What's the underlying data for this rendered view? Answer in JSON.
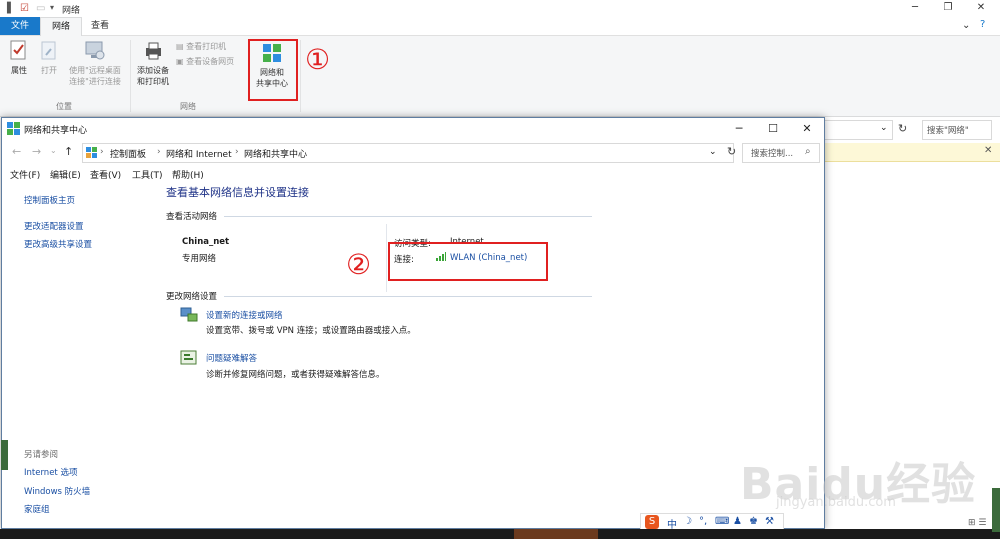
{
  "explorer": {
    "title": "网络",
    "tabs": [
      "文件",
      "网络",
      "查看"
    ],
    "ribbon": {
      "properties": "属性",
      "open": "打开",
      "remote_line1": "使用\"远程桌面",
      "remote_line2": "连接\"进行连接",
      "add_device_line1": "添加设备",
      "add_device_line2": "和打印机",
      "view_printers": "查看打印机",
      "view_device_page": "查看设备网页",
      "sharing_center_line1": "网络和",
      "sharing_center_line2": "共享中心",
      "group_location": "位置",
      "group_network": "网络"
    },
    "search_placeholder": "搜索\"网络\"",
    "annotation_1": "①"
  },
  "window": {
    "title": "网络和共享中心",
    "breadcrumb": [
      "控制面板",
      "网络和 Internet",
      "网络和共享中心"
    ],
    "search_placeholder": "搜索控制...",
    "menu": [
      "文件(F)",
      "编辑(E)",
      "查看(V)",
      "工具(T)",
      "帮助(H)"
    ],
    "sidebar": {
      "links": [
        "控制面板主页",
        "更改适配器设置",
        "更改高级共享设置"
      ],
      "see_also_title": "另请参阅",
      "see_also": [
        "Internet 选项",
        "Windows 防火墙",
        "家庭组"
      ]
    },
    "main": {
      "heading": "查看基本网络信息并设置连接",
      "active_networks": "查看活动网络",
      "network_name": "China_net",
      "network_type": "专用网络",
      "access_type_label": "访问类型:",
      "access_type_value": "Internet",
      "connections_label": "连接:",
      "connection_value": "WLAN (China_net)",
      "change_settings": "更改网络设置",
      "setup_link": "设置新的连接或网络",
      "setup_desc": "设置宽带、拨号或 VPN 连接；或设置路由器或接入点。",
      "troubleshoot_link": "问题疑难解答",
      "troubleshoot_desc": "诊断并修复网络问题，或者获得疑难解答信息。"
    },
    "annotation_2": "②"
  },
  "watermark": {
    "brand": "Baidu经验",
    "url": "jingyan.baidu.com"
  },
  "tray": {
    "ime": "中"
  },
  "colors": {
    "accent": "#1979ca",
    "link": "#1a4fa3",
    "highlight": "#e02020",
    "heading": "#1e3287"
  }
}
